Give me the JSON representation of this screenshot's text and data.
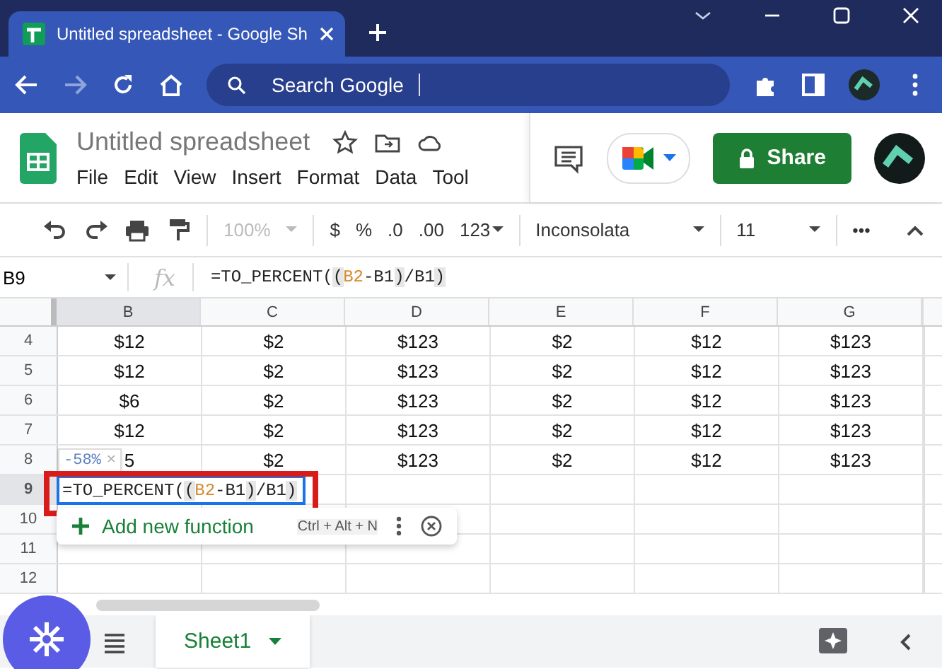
{
  "browser": {
    "tab_title": "Untitled spreadsheet - Google Sh",
    "omnibox": {
      "placeholder": "Search Google"
    }
  },
  "doc": {
    "title": "Untitled spreadsheet",
    "menu": [
      "File",
      "Edit",
      "View",
      "Insert",
      "Format",
      "Data",
      "Tool"
    ],
    "share": "Share"
  },
  "toolbar": {
    "zoom": "100%",
    "items": [
      "$",
      "%",
      ".0",
      ".00",
      "123"
    ],
    "font": "Inconsolata",
    "size": "11",
    "more": "•••"
  },
  "formula_bar": {
    "cell": "B9",
    "fx": "fx",
    "formula": [
      {
        "text": "=TO_PERCENT(",
        "kind": "plain"
      },
      {
        "text": "(",
        "kind": "paren"
      },
      {
        "text": "B2",
        "kind": "ref"
      },
      {
        "text": "-B1",
        "kind": "plain"
      },
      {
        "text": ")",
        "kind": "paren"
      },
      {
        "text": "/B1",
        "kind": "plain"
      },
      {
        "text": ")",
        "kind": "paren"
      }
    ]
  },
  "grid": {
    "columns": [
      {
        "label": "B",
        "selected": true
      },
      {
        "label": "C",
        "selected": false
      },
      {
        "label": "D",
        "selected": false
      },
      {
        "label": "E",
        "selected": false
      },
      {
        "label": "F",
        "selected": false
      },
      {
        "label": "G",
        "selected": false
      }
    ],
    "rows": [
      {
        "number": "4",
        "selected": false,
        "cells": [
          "$12",
          "$2",
          "$123",
          "$2",
          "$12",
          "$123"
        ]
      },
      {
        "number": "5",
        "selected": false,
        "cells": [
          "$12",
          "$2",
          "$123",
          "$2",
          "$12",
          "$123"
        ]
      },
      {
        "number": "6",
        "selected": false,
        "cells": [
          "$6",
          "$2",
          "$123",
          "$2",
          "$12",
          "$123"
        ]
      },
      {
        "number": "7",
        "selected": false,
        "cells": [
          "$12",
          "$2",
          "$123",
          "$2",
          "$12",
          "$123"
        ]
      },
      {
        "number": "8",
        "selected": false,
        "cells": [
          "5",
          "$2",
          "$123",
          "$2",
          "$12",
          "$123"
        ]
      },
      {
        "number": "9",
        "selected": true,
        "cells": []
      },
      {
        "number": "10",
        "selected": false,
        "cells": []
      },
      {
        "number": "11",
        "selected": false,
        "cells": []
      },
      {
        "number": "12",
        "selected": false,
        "cells": []
      }
    ]
  },
  "editor": {
    "formula": [
      {
        "text": "=TO_PERCENT(",
        "kind": "plain"
      },
      {
        "text": "(",
        "kind": "paren"
      },
      {
        "text": "B2",
        "kind": "ref"
      },
      {
        "text": "-B1",
        "kind": "plain"
      },
      {
        "text": ")",
        "kind": "paren"
      },
      {
        "text": "/B1",
        "kind": "plain"
      },
      {
        "text": ")",
        "kind": "paren"
      }
    ]
  },
  "preview": {
    "value": "-58%",
    "close": "×"
  },
  "suggestion": {
    "label": "Add new function",
    "shortcut": "Ctrl + Alt + N"
  },
  "sheets": [
    {
      "name": "Sheet1",
      "selected": true
    }
  ]
}
